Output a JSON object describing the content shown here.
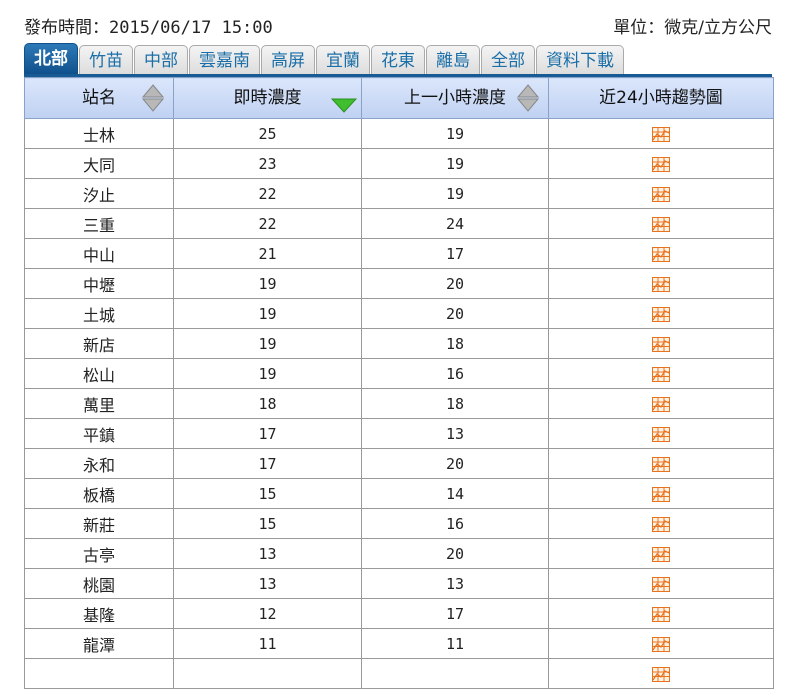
{
  "header": {
    "published_label": "發布時間：",
    "published_time": "2015/06/17 15:00",
    "unit_label": "單位：微克/立方公尺"
  },
  "tabs": [
    {
      "label": "北部",
      "active": true
    },
    {
      "label": "竹苗"
    },
    {
      "label": "中部"
    },
    {
      "label": "雲嘉南"
    },
    {
      "label": "高屏"
    },
    {
      "label": "宜蘭"
    },
    {
      "label": "花東"
    },
    {
      "label": "離島"
    },
    {
      "label": "全部"
    },
    {
      "label": "資料下載"
    }
  ],
  "table": {
    "columns": [
      {
        "label": "站名",
        "sort": "both"
      },
      {
        "label": "即時濃度",
        "sort": "desc-active"
      },
      {
        "label": "上一小時濃度",
        "sort": "both"
      },
      {
        "label": "近24小時趨勢圖",
        "sort": "none"
      }
    ],
    "rows": [
      {
        "station": "士林",
        "now": "25",
        "prev": "19"
      },
      {
        "station": "大同",
        "now": "23",
        "prev": "19"
      },
      {
        "station": "汐止",
        "now": "22",
        "prev": "19"
      },
      {
        "station": "三重",
        "now": "22",
        "prev": "24"
      },
      {
        "station": "中山",
        "now": "21",
        "prev": "17"
      },
      {
        "station": "中壢",
        "now": "19",
        "prev": "20"
      },
      {
        "station": "土城",
        "now": "19",
        "prev": "20"
      },
      {
        "station": "新店",
        "now": "19",
        "prev": "18"
      },
      {
        "station": "松山",
        "now": "19",
        "prev": "16"
      },
      {
        "station": "萬里",
        "now": "18",
        "prev": "18"
      },
      {
        "station": "平鎮",
        "now": "17",
        "prev": "13"
      },
      {
        "station": "永和",
        "now": "17",
        "prev": "20"
      },
      {
        "station": "板橋",
        "now": "15",
        "prev": "14"
      },
      {
        "station": "新莊",
        "now": "15",
        "prev": "16"
      },
      {
        "station": "古亭",
        "now": "13",
        "prev": "20"
      },
      {
        "station": "桃園",
        "now": "13",
        "prev": "13"
      },
      {
        "station": "基隆",
        "now": "12",
        "prev": "17"
      },
      {
        "station": "龍潭",
        "now": "11",
        "prev": "11"
      }
    ],
    "trend_icon": "chart-grid-icon"
  },
  "colors": {
    "tab_active": "#175a94",
    "tab_text": "#1b6fa8",
    "header_bg": "#c9d8f5",
    "sort_active": "#3fbf2f",
    "icon_orange": "#e8731f"
  }
}
